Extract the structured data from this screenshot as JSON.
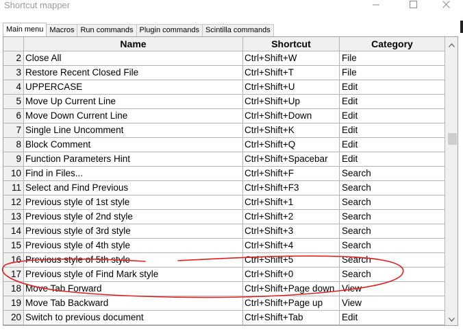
{
  "window": {
    "title": "Shortcut mapper",
    "controls": {
      "minimize": "minimize-icon",
      "maximize": "maximize-icon",
      "close": "close-icon"
    }
  },
  "tabs": [
    {
      "label": "Main menu",
      "active": true
    },
    {
      "label": "Macros",
      "active": false
    },
    {
      "label": "Run commands",
      "active": false
    },
    {
      "label": "Plugin commands",
      "active": false
    },
    {
      "label": "Scintilla commands",
      "active": false
    }
  ],
  "table": {
    "columns": {
      "name": "Name",
      "shortcut": "Shortcut",
      "category": "Category"
    },
    "rows": [
      {
        "num": "2",
        "name": "Close All",
        "shortcut": "Ctrl+Shift+W",
        "category": "File"
      },
      {
        "num": "3",
        "name": "Restore Recent Closed File",
        "shortcut": "Ctrl+Shift+T",
        "category": "File"
      },
      {
        "num": "4",
        "name": "UPPERCASE",
        "shortcut": "Ctrl+Shift+U",
        "category": "Edit"
      },
      {
        "num": "5",
        "name": "Move Up Current Line",
        "shortcut": "Ctrl+Shift+Up",
        "category": "Edit"
      },
      {
        "num": "6",
        "name": "Move Down Current Line",
        "shortcut": "Ctrl+Shift+Down",
        "category": "Edit"
      },
      {
        "num": "7",
        "name": "Single Line Uncomment",
        "shortcut": "Ctrl+Shift+K",
        "category": "Edit"
      },
      {
        "num": "8",
        "name": "Block Comment",
        "shortcut": "Ctrl+Shift+Q",
        "category": "Edit"
      },
      {
        "num": "9",
        "name": "Function Parameters Hint",
        "shortcut": "Ctrl+Shift+Spacebar",
        "category": "Edit"
      },
      {
        "num": "10",
        "name": "Find in Files...",
        "shortcut": "Ctrl+Shift+F",
        "category": "Search"
      },
      {
        "num": "11",
        "name": "Select and Find Previous",
        "shortcut": "Ctrl+Shift+F3",
        "category": "Search"
      },
      {
        "num": "12",
        "name": "Previous style of 1st style",
        "shortcut": "Ctrl+Shift+1",
        "category": "Search"
      },
      {
        "num": "13",
        "name": "Previous style of 2nd style",
        "shortcut": "Ctrl+Shift+2",
        "category": "Search"
      },
      {
        "num": "14",
        "name": "Previous style of 3rd style",
        "shortcut": "Ctrl+Shift+3",
        "category": "Search"
      },
      {
        "num": "15",
        "name": "Previous style of 4th style",
        "shortcut": "Ctrl+Shift+4",
        "category": "Search"
      },
      {
        "num": "16",
        "name": "Previous style of 5th style",
        "shortcut": "Ctrl+Shift+5",
        "category": "Search"
      },
      {
        "num": "17",
        "name": "Previous style of Find Mark style",
        "shortcut": "Ctrl+Shift+0",
        "category": "Search"
      },
      {
        "num": "18",
        "name": "Move Tab Forward",
        "shortcut": "Ctrl+Shift+Page down",
        "category": "View"
      },
      {
        "num": "19",
        "name": "Move Tab Backward",
        "shortcut": "Ctrl+Shift+Page up",
        "category": "View"
      },
      {
        "num": "20",
        "name": "Switch to previous document",
        "shortcut": "Ctrl+Shift+Tab",
        "category": "Edit"
      }
    ]
  },
  "scrollbar": {
    "up": "scroll-up-arrow-icon",
    "down": "scroll-down-arrow-icon"
  },
  "annotation": {
    "color": "#e02020",
    "highlighted_row": "17"
  }
}
